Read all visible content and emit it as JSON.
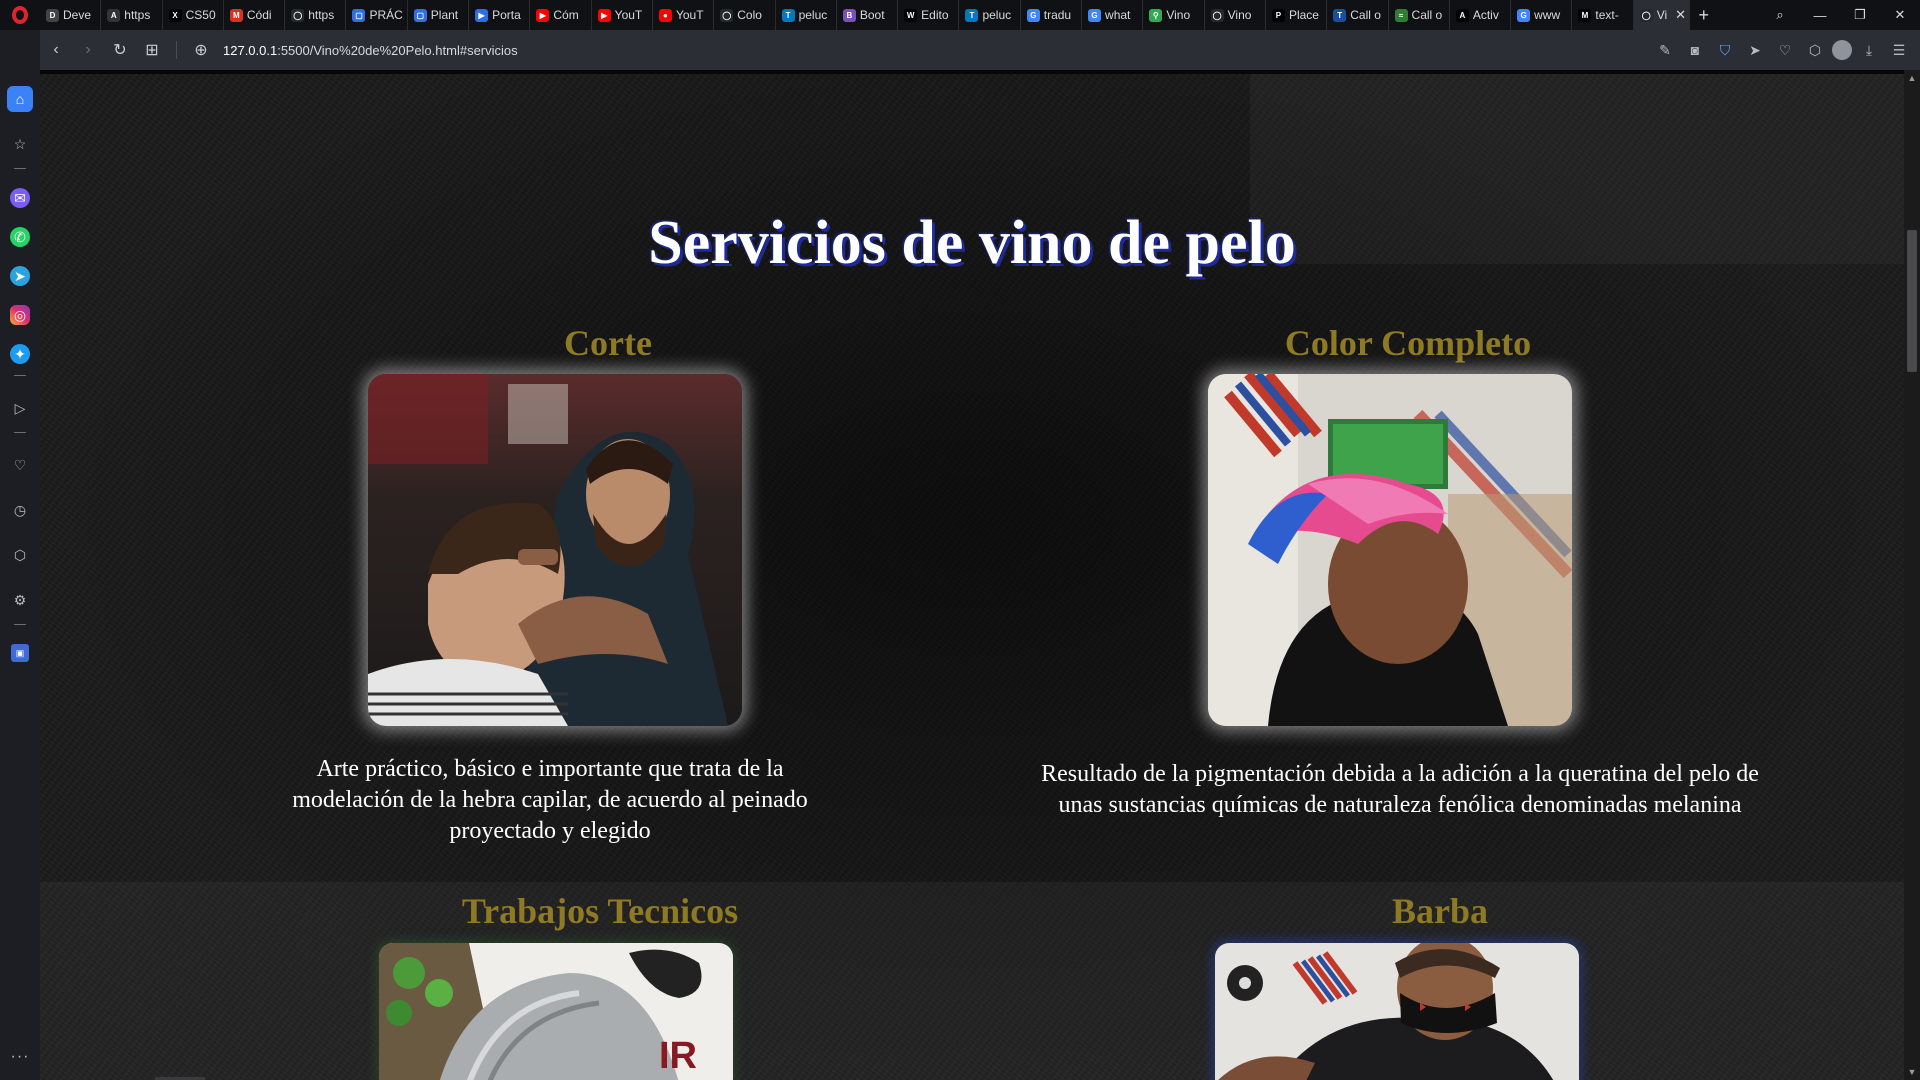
{
  "browser": {
    "tabs": [
      {
        "label": "Deve",
        "icon": "dev-icon",
        "color": "#444444",
        "glyph": "D"
      },
      {
        "label": "https",
        "icon": "a-icon",
        "color": "#333333",
        "glyph": "A"
      },
      {
        "label": "CS50",
        "icon": "x-icon",
        "color": "#000000",
        "glyph": "X"
      },
      {
        "label": "Códi",
        "icon": "gmail-icon",
        "color": "#d93025",
        "glyph": "M"
      },
      {
        "label": "https",
        "icon": "github-icon",
        "color": "#24292e",
        "glyph": "◯"
      },
      {
        "label": "PRÁC",
        "icon": "doc-icon",
        "color": "#2f6fe4",
        "glyph": "▢"
      },
      {
        "label": "Plant",
        "icon": "doc-icon",
        "color": "#2f6fe4",
        "glyph": "▢"
      },
      {
        "label": "Porta",
        "icon": "play-icon",
        "color": "#2f6fe4",
        "glyph": "▶"
      },
      {
        "label": "Cóm",
        "icon": "youtube-icon",
        "color": "#ff0000",
        "glyph": "▶"
      },
      {
        "label": "YouT",
        "icon": "youtube-icon",
        "color": "#ff0000",
        "glyph": "▶"
      },
      {
        "label": "YouT",
        "icon": "youtube-music-icon",
        "color": "#ff0000",
        "glyph": "●"
      },
      {
        "label": "Colo",
        "icon": "github-icon",
        "color": "#24292e",
        "glyph": "◯"
      },
      {
        "label": "peluc",
        "icon": "trello-icon",
        "color": "#0079bf",
        "glyph": "T"
      },
      {
        "label": "Boot",
        "icon": "bootstrap-icon",
        "color": "#7952b3",
        "glyph": "B"
      },
      {
        "label": "Edito",
        "icon": "wix-icon",
        "color": "#000000",
        "glyph": "W"
      },
      {
        "label": "peluc",
        "icon": "trello-icon",
        "color": "#0079bf",
        "glyph": "T"
      },
      {
        "label": "tradu",
        "icon": "google-icon",
        "color": "#4285f4",
        "glyph": "G"
      },
      {
        "label": "what",
        "icon": "google-icon",
        "color": "#4285f4",
        "glyph": "G"
      },
      {
        "label": "Vino",
        "icon": "maps-icon",
        "color": "#34a853",
        "glyph": "⚲"
      },
      {
        "label": "Vino",
        "icon": "github-icon",
        "color": "#24292e",
        "glyph": "◯"
      },
      {
        "label": "Place",
        "icon": "p-icon",
        "color": "#000000",
        "glyph": "P"
      },
      {
        "label": "Call o",
        "icon": "tyc-icon",
        "color": "#1a4fa0",
        "glyph": "T"
      },
      {
        "label": "Call o",
        "icon": "ooo-icon",
        "color": "#2e7d32",
        "glyph": "≈"
      },
      {
        "label": "Activ",
        "icon": "a-triangle-icon",
        "color": "#000000",
        "glyph": "A"
      },
      {
        "label": "www",
        "icon": "google-icon",
        "color": "#4285f4",
        "glyph": "G"
      },
      {
        "label": "text-",
        "icon": "m-icon",
        "color": "#000000",
        "glyph": "M"
      }
    ],
    "active_tab": {
      "label": "Vi",
      "icon": "github-icon"
    },
    "url_host": "127.0.0.1",
    "url_rest": ":5500/Vino%20de%20Pelo.html#servicios"
  },
  "page": {
    "title": "Servicios de vino de pelo",
    "services": [
      {
        "title": "Corte",
        "description": "Arte práctico, básico e importante que trata de la modelación de la hebra capilar, de acuerdo al peinado proyectado y elegido",
        "image": "barber-cutting-hair-photo"
      },
      {
        "title": "Color Completo",
        "description": "Resultado de la pigmentación debida a la adición a la queratina del pelo de unas sustancias químicas de naturaleza fenólica denominadas melanina",
        "image": "pink-dyed-hair-photo"
      },
      {
        "title": "Trabajos Tecnicos",
        "description": "",
        "image": "gray-hair-technical-work-photo"
      },
      {
        "title": "Barba",
        "description": "",
        "image": "barber-beard-trim-photo"
      }
    ]
  },
  "colors": {
    "title_text": "#ffffff",
    "title_shadow": "#1e2a9a",
    "service_title": "#8e7a22",
    "description_text": "#ffffff",
    "background": "#1a1a1b"
  }
}
